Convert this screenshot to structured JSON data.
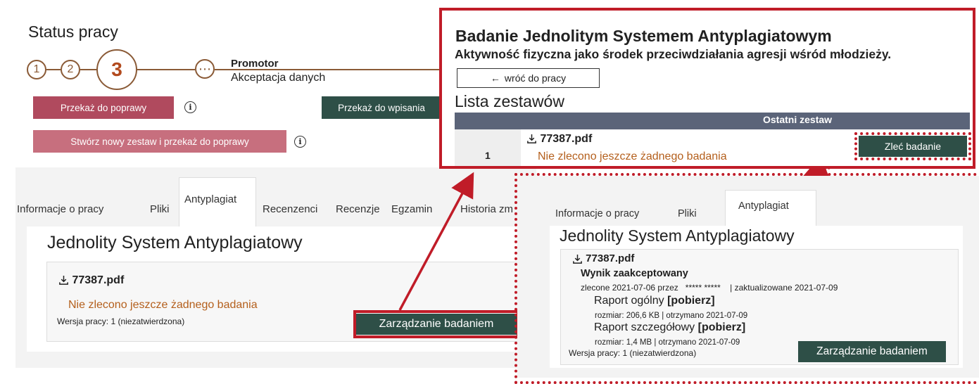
{
  "status": {
    "title": "Status pracy",
    "steps": [
      "1",
      "2",
      "3"
    ],
    "pending_icon": "ellipsis-icon",
    "stage_role": "Promotor",
    "stage_desc": "Akceptacja danych",
    "btn_return": "Przekaż do poprawy",
    "btn_forward": "Przekaż do wpisania",
    "btn_new_set": "Stwórz nowy zestaw i przekaż do poprawy",
    "info_glyph": "i"
  },
  "tabs": [
    "Informacje o pracy",
    "Pliki",
    "Antyplagiat",
    "Recenzenci",
    "Recenzje",
    "Egzamin",
    "Historia zm"
  ],
  "jsa": {
    "title": "Jednolity System Antyplagiatowy",
    "file": "77387.pdf",
    "no_study": "Nie zlecono jeszcze żadnego badania",
    "version": "Wersja pracy: 1 (niezatwierdzona)",
    "manage_btn": "Zarządzanie badaniem"
  },
  "overlay": {
    "title": "Badanie Jednolitym Systemem Antyplagiatowym",
    "subtitle": "Aktywność fizyczna jako środek przeciwdziałania agresji wśród młodzieży.",
    "back_arrow": "←",
    "back_label": "wróć do pracy",
    "list_title": "Lista zestawów",
    "table_header": "Ostatni zestaw",
    "row_number": "1",
    "file": "77387.pdf",
    "no_study": "Nie zlecono jeszcze żadnego badania",
    "order_btn": "Zleć badanie"
  },
  "result": {
    "tabs": [
      "Informacje o pracy",
      "Pliki",
      "Antyplagiat"
    ],
    "title": "Jednolity System Antyplagiatowy",
    "file": "77387.pdf",
    "accepted": "Wynik zaakceptowany",
    "ordered": "zlecone 2021-07-06 przez",
    "masked_user": "***** *****",
    "updated": "| zaktualizowane 2021-07-09",
    "general_report": "Raport ogólny",
    "download": "[pobierz]",
    "general_meta": "rozmiar: 206,6 KB | otrzymano 2021-07-09",
    "detailed_report": "Raport szczegółowy",
    "detailed_meta": "rozmiar: 1,4 MB | otrzymano 2021-07-09",
    "version": "Wersja pracy: 1 (niezatwierdzona)",
    "manage_btn": "Zarządzanie badaniem"
  },
  "colors": {
    "annotation_red": "#c01c28",
    "button_dark": "#2e4f47",
    "button_red": "#b04a5e",
    "warning_orange": "#b45f1c",
    "step_brown": "#8a5a36"
  }
}
